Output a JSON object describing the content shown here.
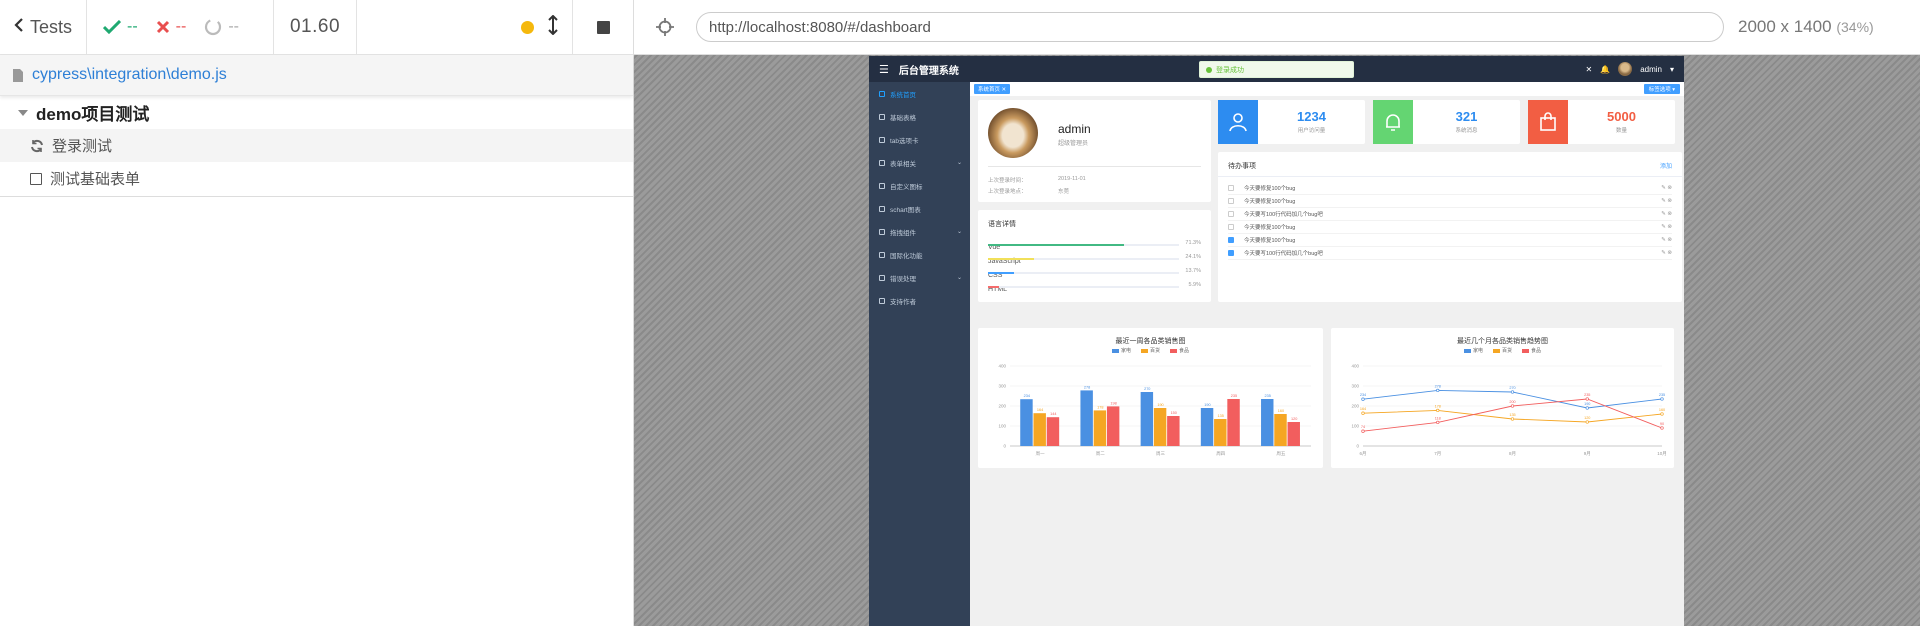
{
  "reporter": {
    "back_label": "Tests",
    "passed": "--",
    "failed": "--",
    "pending": "--",
    "duration": "01.60",
    "spec_path": "cypress\\integration\\demo.js",
    "suite_title": "demo项目测试",
    "tests": [
      {
        "title": "登录测试",
        "state": "running"
      },
      {
        "title": "测试基础表单",
        "state": "pending"
      }
    ]
  },
  "aut": {
    "url": "http://localhost:8080/#/dashboard",
    "viewport_size": "2000 x 1400",
    "scale": "(34%)"
  },
  "app": {
    "title": "后台管理系统",
    "toast": "登录成功",
    "user_menu": "admin",
    "tag_active": "系统首页",
    "tag_options": "标签选项",
    "sidebar": [
      {
        "label": "系统首页",
        "active": true,
        "arrow": ""
      },
      {
        "label": "基础表格",
        "active": false,
        "arrow": ""
      },
      {
        "label": "tab选项卡",
        "active": false,
        "arrow": ""
      },
      {
        "label": "表单相关",
        "active": false,
        "arrow": "⌄"
      },
      {
        "label": "自定义图标",
        "active": false,
        "arrow": ""
      },
      {
        "label": "schart图表",
        "active": false,
        "arrow": ""
      },
      {
        "label": "拖拽组件",
        "active": false,
        "arrow": "⌄"
      },
      {
        "label": "国际化功能",
        "active": false,
        "arrow": ""
      },
      {
        "label": "错误处理",
        "active": false,
        "arrow": "⌄"
      },
      {
        "label": "支持作者",
        "active": false,
        "arrow": ""
      }
    ],
    "user": {
      "name": "admin",
      "role": "超级管理员",
      "last_login_time_label": "上次登录时间：",
      "last_login_time": "2019-11-01",
      "last_login_place_label": "上次登录地点：",
      "last_login_place": "东莞"
    },
    "languages": {
      "title": "语言详情",
      "items": [
        {
          "name": "Vue",
          "percent": 71.3,
          "label": "71.3%",
          "color": "#42b983"
        },
        {
          "name": "JavaScript",
          "percent": 24.1,
          "label": "24.1%",
          "color": "#f1e05a"
        },
        {
          "name": "CSS",
          "percent": 13.7,
          "label": "13.7%",
          "color": "#409eff"
        },
        {
          "name": "HTML",
          "percent": 5.9,
          "label": "5.9%",
          "color": "#f56c6c"
        }
      ]
    },
    "stats": [
      {
        "value": "1234",
        "label": "用户访问量",
        "color": "#2d8cf0",
        "num_color": "#2d8cf0",
        "icon": "user-icon"
      },
      {
        "value": "321",
        "label": "系统消息",
        "color": "#64d572",
        "num_color": "#2d8cf0",
        "icon": "bell-icon"
      },
      {
        "value": "5000",
        "label": "数量",
        "color": "#f25e43",
        "num_color": "#f25e43",
        "icon": "bag-icon"
      }
    ],
    "todo": {
      "title": "待办事项",
      "add_label": "添加",
      "edit_label": "✎ ⊗",
      "items": [
        {
          "title": "今天要修复100个bug",
          "done": false
        },
        {
          "title": "今天要修复100个bug",
          "done": false
        },
        {
          "title": "今天要写100行代码加几个bug吧",
          "done": false
        },
        {
          "title": "今天要修复100个bug",
          "done": false
        },
        {
          "title": "今天要修复100个bug",
          "done": true
        },
        {
          "title": "今天要写100行代码加几个bug吧",
          "done": true
        }
      ]
    }
  },
  "chart_data": [
    {
      "type": "bar",
      "title": "最近一周各品类销售图",
      "categories": [
        "周一",
        "周二",
        "周三",
        "周四",
        "周五"
      ],
      "ylim": [
        0,
        400
      ],
      "yticks": [
        "400",
        "300",
        "200",
        "100",
        "0"
      ],
      "series": [
        {
          "name": "家电",
          "color": "#4a90e2",
          "values": [
            234,
            278,
            270,
            190,
            235
          ]
        },
        {
          "name": "百货",
          "color": "#f5a623",
          "values": [
            164,
            178,
            190,
            135,
            160
          ]
        },
        {
          "name": "食品",
          "color": "#f25e5e",
          "values": [
            144,
            198,
            150,
            235,
            120
          ]
        }
      ]
    },
    {
      "type": "line",
      "title": "最近几个月各品类销售趋势图",
      "categories": [
        "6月",
        "7月",
        "8月",
        "9月",
        "10月"
      ],
      "ylim": [
        0,
        400
      ],
      "yticks": [
        "400",
        "300",
        "200",
        "100",
        "0"
      ],
      "series": [
        {
          "name": "家电",
          "color": "#4a90e2",
          "values": [
            234,
            278,
            270,
            190,
            235
          ]
        },
        {
          "name": "百货",
          "color": "#f5a623",
          "values": [
            164,
            178,
            135,
            120,
            160
          ]
        },
        {
          "name": "食品",
          "color": "#f25e5e",
          "values": [
            74,
            118,
            200,
            235,
            90
          ]
        }
      ]
    }
  ]
}
